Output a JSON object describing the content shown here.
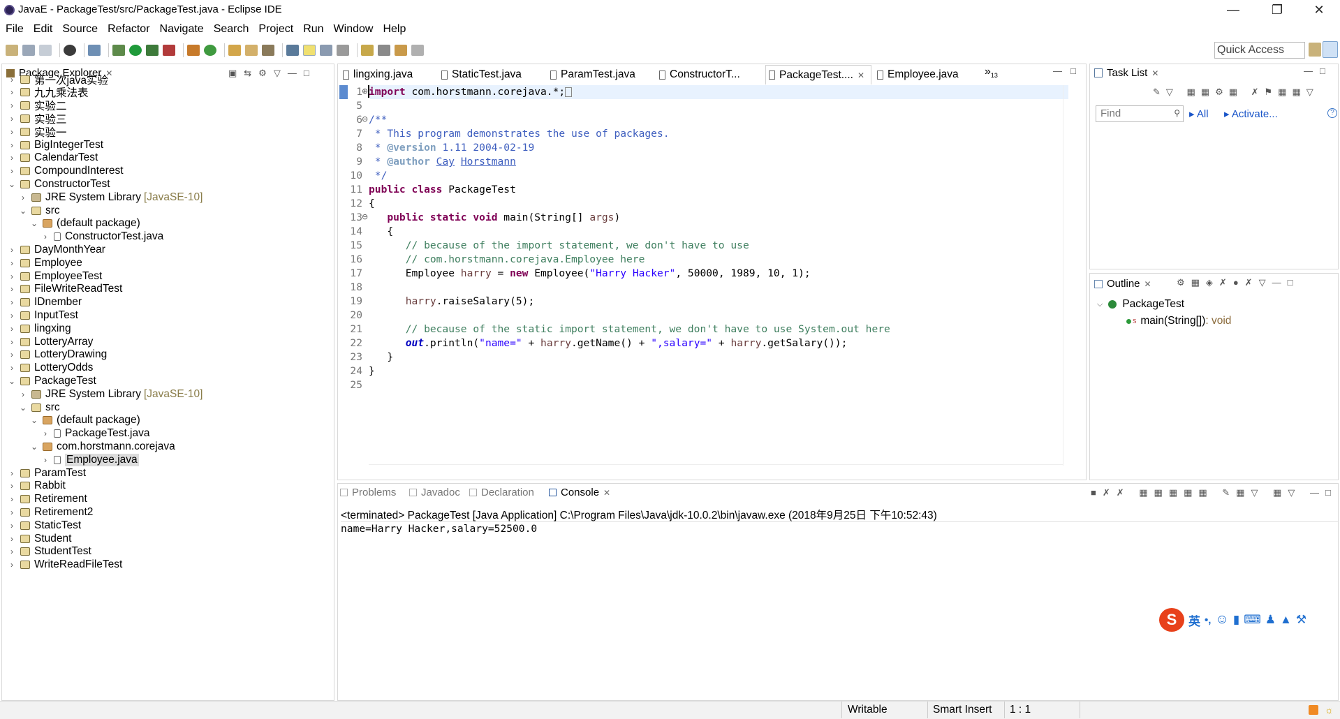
{
  "window": {
    "title": "JavaE - PackageTest/src/PackageTest.java - Eclipse IDE"
  },
  "menu": [
    "File",
    "Edit",
    "Source",
    "Refactor",
    "Navigate",
    "Search",
    "Project",
    "Run",
    "Window",
    "Help"
  ],
  "toolbar": {
    "quick_access": "Quick Access"
  },
  "package_explorer": {
    "title": "Package Explorer",
    "items": [
      {
        "label": "第一次java实验",
        "indent": 0,
        "open": false,
        "kind": "project"
      },
      {
        "label": "九九乘法表",
        "indent": 0,
        "open": false,
        "kind": "project"
      },
      {
        "label": "实验二",
        "indent": 0,
        "open": false,
        "kind": "project"
      },
      {
        "label": "实验三",
        "indent": 0,
        "open": false,
        "kind": "project"
      },
      {
        "label": "实验一",
        "indent": 0,
        "open": false,
        "kind": "project"
      },
      {
        "label": "BigIntegerTest",
        "indent": 0,
        "open": false,
        "kind": "project"
      },
      {
        "label": "CalendarTest",
        "indent": 0,
        "open": false,
        "kind": "project"
      },
      {
        "label": "CompoundInterest",
        "indent": 0,
        "open": false,
        "kind": "project"
      },
      {
        "label": "ConstructorTest",
        "indent": 0,
        "open": true,
        "kind": "project"
      },
      {
        "label": "JRE System Library",
        "extra": "[JavaSE-10]",
        "indent": 1,
        "open": false,
        "kind": "lib"
      },
      {
        "label": "src",
        "indent": 1,
        "open": true,
        "kind": "src"
      },
      {
        "label": "(default package)",
        "indent": 2,
        "open": true,
        "kind": "pkg"
      },
      {
        "label": "ConstructorTest.java",
        "indent": 3,
        "open": false,
        "kind": "file"
      },
      {
        "label": "DayMonthYear",
        "indent": 0,
        "open": false,
        "kind": "project"
      },
      {
        "label": "Employee",
        "indent": 0,
        "open": false,
        "kind": "project"
      },
      {
        "label": "EmployeeTest",
        "indent": 0,
        "open": false,
        "kind": "project"
      },
      {
        "label": "FileWriteReadTest",
        "indent": 0,
        "open": false,
        "kind": "project"
      },
      {
        "label": "IDnember",
        "indent": 0,
        "open": false,
        "kind": "project"
      },
      {
        "label": "InputTest",
        "indent": 0,
        "open": false,
        "kind": "project"
      },
      {
        "label": "lingxing",
        "indent": 0,
        "open": false,
        "kind": "project"
      },
      {
        "label": "LotteryArray",
        "indent": 0,
        "open": false,
        "kind": "project"
      },
      {
        "label": "LotteryDrawing",
        "indent": 0,
        "open": false,
        "kind": "project"
      },
      {
        "label": "LotteryOdds",
        "indent": 0,
        "open": false,
        "kind": "project"
      },
      {
        "label": "PackageTest",
        "indent": 0,
        "open": true,
        "kind": "project"
      },
      {
        "label": "JRE System Library",
        "extra": "[JavaSE-10]",
        "indent": 1,
        "open": false,
        "kind": "lib"
      },
      {
        "label": "src",
        "indent": 1,
        "open": true,
        "kind": "src"
      },
      {
        "label": "(default package)",
        "indent": 2,
        "open": true,
        "kind": "pkg"
      },
      {
        "label": "PackageTest.java",
        "indent": 3,
        "open": false,
        "kind": "file"
      },
      {
        "label": "com.horstmann.corejava",
        "indent": 2,
        "open": true,
        "kind": "pkg"
      },
      {
        "label": "Employee.java",
        "indent": 3,
        "open": false,
        "kind": "file",
        "selected": true
      },
      {
        "label": "ParamTest",
        "indent": 0,
        "open": false,
        "kind": "project"
      },
      {
        "label": "Rabbit",
        "indent": 0,
        "open": false,
        "kind": "project"
      },
      {
        "label": "Retirement",
        "indent": 0,
        "open": false,
        "kind": "project"
      },
      {
        "label": "Retirement2",
        "indent": 0,
        "open": false,
        "kind": "project"
      },
      {
        "label": "StaticTest",
        "indent": 0,
        "open": false,
        "kind": "project"
      },
      {
        "label": "Student",
        "indent": 0,
        "open": false,
        "kind": "project"
      },
      {
        "label": "StudentTest",
        "indent": 0,
        "open": false,
        "kind": "project"
      },
      {
        "label": "WriteReadFileTest",
        "indent": 0,
        "open": false,
        "kind": "project"
      }
    ]
  },
  "editor": {
    "tabs": [
      {
        "label": "lingxing.java"
      },
      {
        "label": "StaticTest.java"
      },
      {
        "label": "ParamTest.java"
      },
      {
        "label": "ConstructorT..."
      },
      {
        "label": "PackageTest....",
        "active": true
      },
      {
        "label": "Employee.java"
      }
    ],
    "overflow": "»",
    "overflow_count": "13",
    "line_numbers": [
      "1",
      "5",
      "6",
      "7",
      "8",
      "9",
      "10",
      "11",
      "12",
      "13",
      "14",
      "15",
      "16",
      "17",
      "18",
      "19",
      "20",
      "21",
      "22",
      "23",
      "24",
      "25"
    ],
    "fold_markers": [
      "⊕",
      "⊖",
      "⊖"
    ]
  },
  "task_list": {
    "title": "Task List",
    "find_placeholder": "Find",
    "all": "All",
    "activate": "Activate..."
  },
  "outline": {
    "title": "Outline",
    "class_name": "PackageTest",
    "method": "main(String[])",
    "method_type": " : void",
    "static_mark": "S"
  },
  "bottom_tabs": [
    {
      "label": "Problems"
    },
    {
      "label": "Javadoc"
    },
    {
      "label": "Declaration"
    },
    {
      "label": "Console",
      "active": true
    }
  ],
  "console": {
    "header": "<terminated> PackageTest [Java Application] C:\\Program Files\\Java\\jdk-10.0.2\\bin\\javaw.exe (2018年9月25日 下午10:52:43)",
    "output": "name=Harry Hacker,salary=52500.0"
  },
  "ime": {
    "logo": "S",
    "mode": "英",
    "punct": "•,"
  },
  "status": {
    "writable": "Writable",
    "insert": "Smart Insert",
    "position": "1 : 1"
  }
}
